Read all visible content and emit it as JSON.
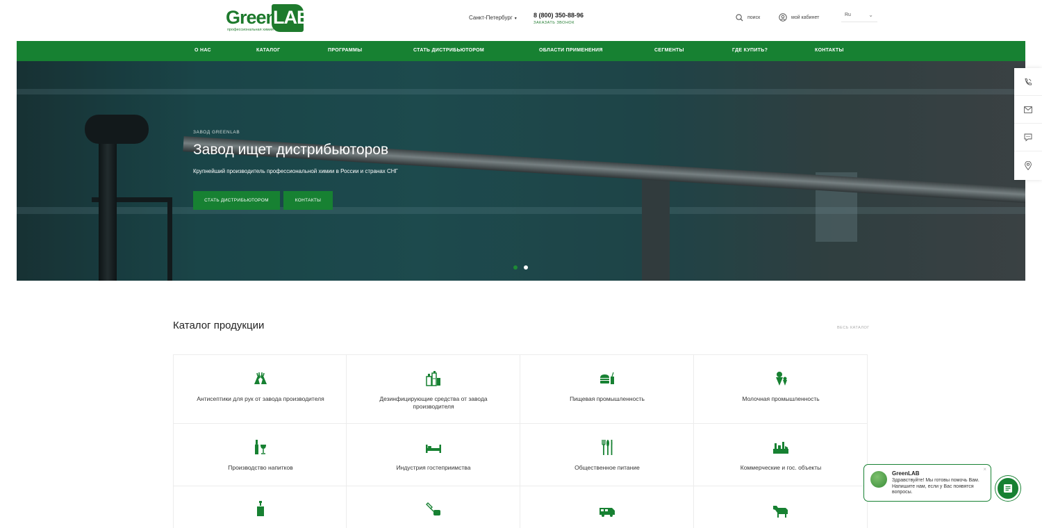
{
  "brand": {
    "name_green": "Green",
    "name_lab": "LAB",
    "tagline": "профессиональная химия",
    "accent": "#178132"
  },
  "header": {
    "city": "Санкт-Петербург",
    "phone": "8 (800) 350-88-96",
    "callback": "ЗАКАЗАТЬ ЗВОНОК",
    "search": "поиск",
    "account": "мой кабинет",
    "language": "Ru"
  },
  "nav": [
    "О НАС",
    "КАТАЛОГ",
    "ПРОГРАММЫ",
    "СТАТЬ ДИСТРИБЬЮТОРОМ",
    "ОБЛАСТИ ПРИМЕНЕНИЯ",
    "СЕГМЕНТЫ",
    "ГДЕ КУПИТЬ?",
    "КОНТАКТЫ"
  ],
  "hero": {
    "eyebrow": "ЗАВОД GREENLAB",
    "title": "Завод ищет дистрибьюторов",
    "subtitle": "Крупнейший производитель профессиональной химии в России и странах СНГ",
    "button_primary": "СТАТЬ ДИСТРИБЬЮТОРОМ",
    "button_secondary": "КОНТАКТЫ",
    "slides": 2,
    "active_slide": 1
  },
  "sidebar_icons": [
    "phone-icon",
    "mail-icon",
    "chat-icon",
    "location-icon"
  ],
  "catalog": {
    "title": "Каталог продукции",
    "all_link": "ВЕСЬ КАТАЛОГ",
    "items": [
      {
        "label": "Антисептики для рук от завода производителя",
        "icon": "gloves-icon"
      },
      {
        "label": "Дезинфицирующие средства от завода производителя",
        "icon": "bottles-icon"
      },
      {
        "label": "Пищевая промышленность",
        "icon": "burger-icon"
      },
      {
        "label": "Молочная промышленность",
        "icon": "ice-cream-icon"
      },
      {
        "label": "Производство напитков",
        "icon": "wine-icon"
      },
      {
        "label": "Индустрия гостеприимства",
        "icon": "bed-icon"
      },
      {
        "label": "Общественное питание",
        "icon": "cutlery-icon"
      },
      {
        "label": "Коммерческие и гос. объекты",
        "icon": "factory-icon"
      },
      {
        "label": "",
        "icon": "soap-dispenser-icon"
      },
      {
        "label": "",
        "icon": "cleaning-icon"
      },
      {
        "label": "",
        "icon": "van-icon"
      },
      {
        "label": "",
        "icon": "cow-icon"
      }
    ]
  },
  "chat": {
    "name": "GreenLAB",
    "message": "Здравствуйте! Мы готовы помочь Вам. Напишите нам, если у Вас появятся вопросы.",
    "close": "×"
  }
}
